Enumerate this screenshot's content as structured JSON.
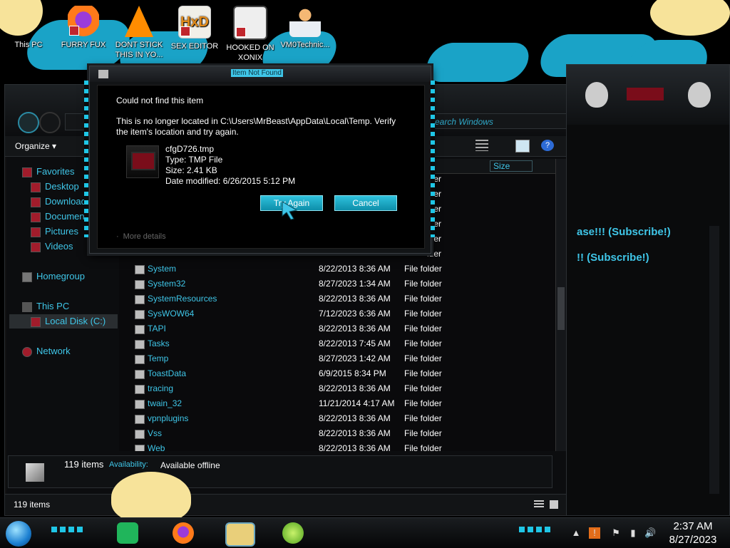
{
  "desktop_icons": [
    {
      "label": "This PC",
      "icon": "computer-icon"
    },
    {
      "label": "FURRY FUX",
      "icon": "firefox-icon"
    },
    {
      "label": "DONT STICK THIS IN YO...",
      "icon": "vlc-cone-icon"
    },
    {
      "label": "SEX EDITOR",
      "icon": "hxd-editor-icon"
    },
    {
      "label": "HOOKED ON XONIX",
      "icon": "game-icon"
    },
    {
      "label": "VM0Technic...",
      "icon": "doctor-icon"
    }
  ],
  "explorer": {
    "search_placeholder": "Search Windows",
    "organize_label": "Organize",
    "column_size": "Size",
    "nav": {
      "favorites": "Favorites",
      "desktop": "Desktop",
      "downloads": "Download",
      "documents": "Documen",
      "pictures": "Pictures",
      "videos": "Videos",
      "homegroup": "Homegroup",
      "this_pc": "This PC",
      "local_disk": "Local Disk (C:)",
      "network": "Network"
    },
    "partial_type": "lder",
    "rows": [
      {
        "name": "System",
        "date": "8/22/2013 8:36 AM",
        "type": "File folder"
      },
      {
        "name": "System32",
        "date": "8/27/2023 1:34 AM",
        "type": "File folder"
      },
      {
        "name": "SystemResources",
        "date": "8/22/2013 8:36 AM",
        "type": "File folder"
      },
      {
        "name": "SysWOW64",
        "date": "7/12/2023 6:36 AM",
        "type": "File folder"
      },
      {
        "name": "TAPI",
        "date": "8/22/2013 8:36 AM",
        "type": "File folder"
      },
      {
        "name": "Tasks",
        "date": "8/22/2013 7:45 AM",
        "type": "File folder"
      },
      {
        "name": "Temp",
        "date": "8/27/2023 1:42 AM",
        "type": "File folder"
      },
      {
        "name": "ToastData",
        "date": "6/9/2015 8:34 PM",
        "type": "File folder"
      },
      {
        "name": "tracing",
        "date": "8/22/2013 8:36 AM",
        "type": "File folder"
      },
      {
        "name": "twain_32",
        "date": "11/21/2014 4:17 AM",
        "type": "File folder"
      },
      {
        "name": "vpnplugins",
        "date": "8/22/2013 8:36 AM",
        "type": "File folder"
      },
      {
        "name": "Vss",
        "date": "8/22/2013 8:36 AM",
        "type": "File folder"
      },
      {
        "name": "Web",
        "date": "8/22/2013 8:36 AM",
        "type": "File folder"
      }
    ],
    "details_count": "119 items",
    "availability_label": "Availability:",
    "availability_value": "Available offline",
    "status_count": "119 items"
  },
  "right_panel": {
    "line1": "ase!!! (Subscribe!)",
    "line2": "!! (Subscribe!)"
  },
  "dialog": {
    "title": "Item Not Found",
    "heading": "Could not find this item",
    "message": "This is no longer located in C:\\Users\\MrBeast\\AppData\\Local\\Temp. Verify the item's location and try again.",
    "file_name": "cfgD726.tmp",
    "file_type": "Type: TMP File",
    "file_size": "Size: 2.41 KB",
    "file_modified": "Date modified: 6/26/2015 5:12 PM",
    "try_again": "Try Again",
    "cancel": "Cancel",
    "more_details": "More details"
  },
  "taskbar": {
    "time": "2:37 AM",
    "date": "8/27/2023"
  },
  "colors": {
    "accent": "#3fc6e8",
    "button": "#1aa3c7",
    "alert": "#a11c2b"
  }
}
